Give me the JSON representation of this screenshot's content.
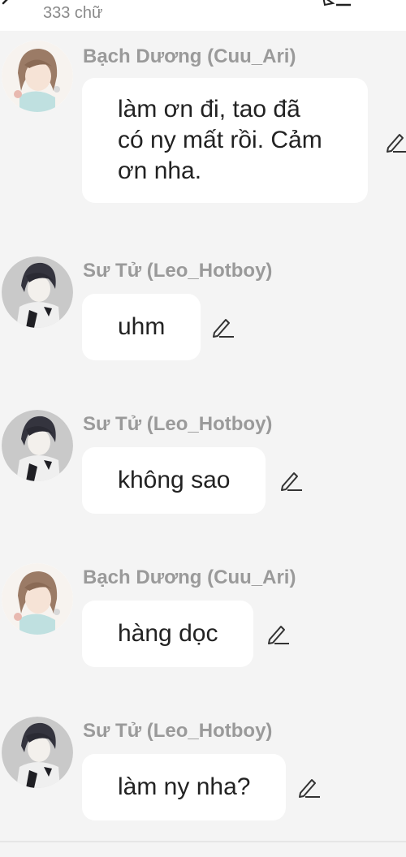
{
  "header": {
    "word_count": "333 chữ"
  },
  "messages": [
    {
      "sender": "Bạch Dương (Cuu_Ari)",
      "avatar": "girl-avatar",
      "text": "làm ơn đi, tao đã có ny mất rồi. Cảm ơn nha."
    },
    {
      "sender": "Sư Tử (Leo_Hotboy)",
      "avatar": "boy-avatar",
      "text": "uhm"
    },
    {
      "sender": "Sư Tử (Leo_Hotboy)",
      "avatar": "boy-avatar",
      "text": "không sao"
    },
    {
      "sender": "Bạch Dương (Cuu_Ari)",
      "avatar": "girl-avatar",
      "text": "hàng dọc"
    },
    {
      "sender": "Sư Tử (Leo_Hotboy)",
      "avatar": "boy-avatar",
      "text": "làm ny nha?"
    }
  ],
  "icons": {
    "back": "back-arrow-icon",
    "edit": "pencil-icon",
    "topbar_edit": "edit-list-icon"
  },
  "colors": {
    "background": "#f4f4f4",
    "bubble": "#ffffff",
    "sender": "#9a9a9a",
    "text": "#222222"
  }
}
